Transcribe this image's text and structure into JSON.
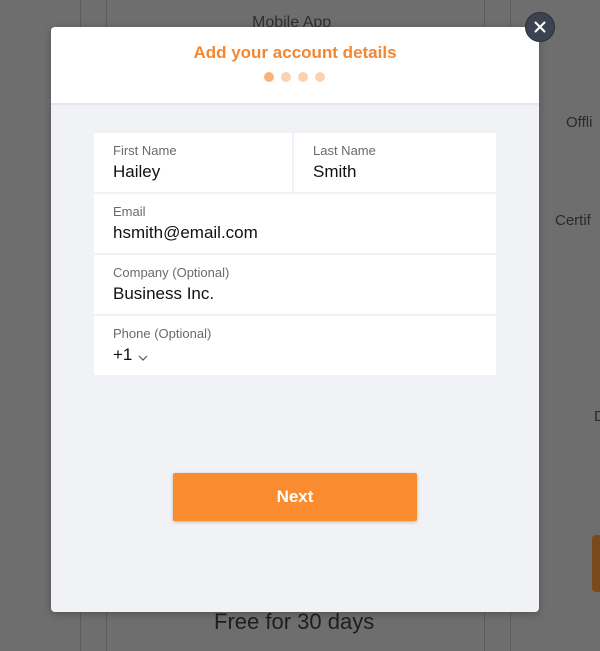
{
  "background": {
    "title": "Mobile App",
    "right_labels": [
      "Offli",
      "Certif",
      "D"
    ],
    "footer": "Free for 30 days"
  },
  "modal": {
    "title": "Add your account details",
    "steps": {
      "total": 4,
      "current": 1
    },
    "fields": {
      "first_name": {
        "label": "First Name",
        "value": "Hailey"
      },
      "last_name": {
        "label": "Last Name",
        "value": "Smith"
      },
      "email": {
        "label": "Email",
        "value": "hsmith@email.com"
      },
      "company": {
        "label": "Company (Optional)",
        "value": "Business Inc."
      },
      "phone": {
        "label": "Phone (Optional)",
        "country_code": "+1"
      }
    },
    "next_label": "Next"
  },
  "icons": {
    "close": "close-icon",
    "chevron": "chevron-down-icon"
  },
  "colors": {
    "accent": "#f5862e",
    "button": "#fb8b2f",
    "close_bg": "#3c4350"
  }
}
